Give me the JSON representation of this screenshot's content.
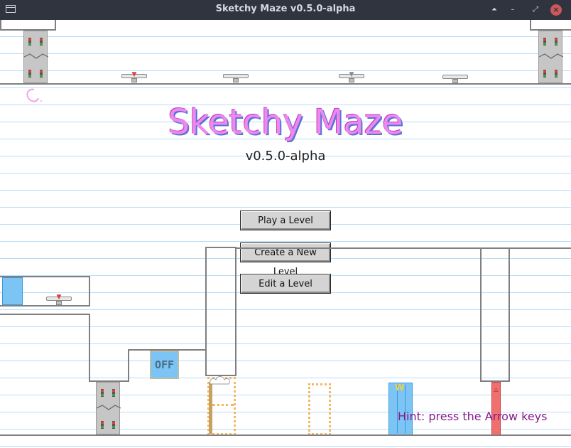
{
  "window": {
    "title": "Sketchy Maze v0.5.0-alpha",
    "controls": {
      "shade": "⏶",
      "minimize": "–",
      "maximize": "⤢",
      "close": "×"
    }
  },
  "game": {
    "title": "Sketchy Maze",
    "version": "v0.5.0-alpha",
    "menu": {
      "play": "Play a Level",
      "create": "Create a New Level",
      "edit": "Edit a Level"
    },
    "hint": "Hint: press the Arrow keys",
    "switch_label": "OFF"
  },
  "colors": {
    "title_pink": "#ee88ee",
    "door_blue": "#7cc4f4",
    "red_door": "#f07070",
    "dotted_orange": "#f4b860",
    "hint_purple": "#8a1a8a"
  }
}
